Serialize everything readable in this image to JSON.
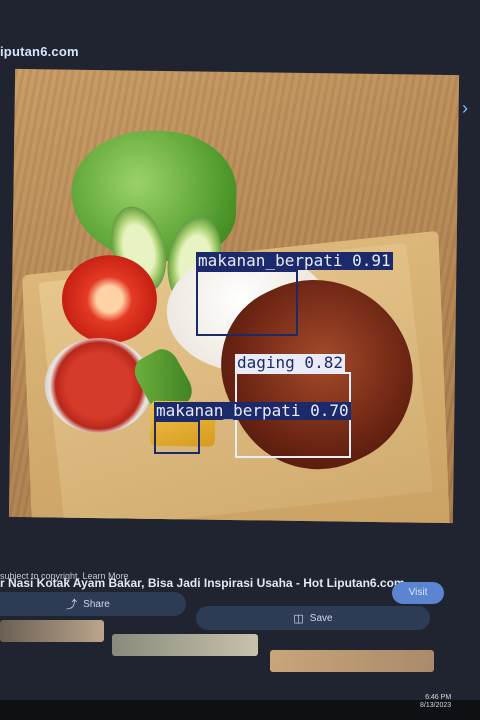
{
  "site": {
    "name": "iputan6.com"
  },
  "nav": {
    "prev_icon": "‹",
    "next_icon": "›"
  },
  "detections": [
    {
      "label": "makanan_berpati 0.91",
      "style": "dark"
    },
    {
      "label": "daging 0.82",
      "style": "light"
    },
    {
      "label": "makanan_berpati 0.70",
      "style": "dark"
    }
  ],
  "caption": {
    "title": "r Nasi Kotak Ayam Bakar, Bisa Jadi Inspirasi Usaha - Hot Liputan6.com",
    "copyright": "subject to copyright. Learn More"
  },
  "actions": {
    "visit": "Visit",
    "share": "Share",
    "save": "Save"
  },
  "clock": {
    "time": "6:46 PM",
    "date": "8/13/2023"
  },
  "colors": {
    "box_dark": "#1c2a6b",
    "box_light": "#e9ecf7",
    "accent": "#5b84d1"
  }
}
